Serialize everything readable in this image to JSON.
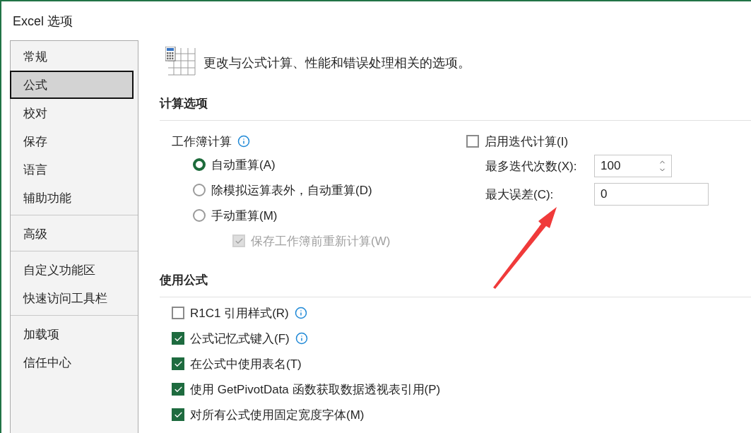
{
  "window": {
    "title": "Excel 选项"
  },
  "sidebar": {
    "groups": [
      [
        {
          "label": "常规",
          "selected": false
        },
        {
          "label": "公式",
          "selected": true
        },
        {
          "label": "校对",
          "selected": false
        },
        {
          "label": "保存",
          "selected": false
        },
        {
          "label": "语言",
          "selected": false
        },
        {
          "label": "辅助功能",
          "selected": false
        }
      ],
      [
        {
          "label": "高级",
          "selected": false
        }
      ],
      [
        {
          "label": "自定义功能区",
          "selected": false
        },
        {
          "label": "快速访问工具栏",
          "selected": false
        }
      ],
      [
        {
          "label": "加载项",
          "selected": false
        },
        {
          "label": "信任中心",
          "selected": false
        }
      ]
    ]
  },
  "header": {
    "text": "更改与公式计算、性能和错误处理相关的选项。"
  },
  "calculation": {
    "title": "计算选项",
    "workbook_label": "工作簿计算",
    "workbook_info": true,
    "radios": [
      {
        "label": "自动重算(A)",
        "selected": true
      },
      {
        "label": "除模拟运算表外，自动重算(D)",
        "selected": false
      },
      {
        "label": "手动重算(M)",
        "selected": false
      }
    ],
    "save_before": {
      "label": "保存工作簿前重新计算(W)",
      "checked": true,
      "disabled": true
    },
    "iteration": {
      "label": "启用迭代计算(I)",
      "checked": false
    },
    "fields": [
      {
        "label": "最多迭代次数(X):",
        "value": "100",
        "kind": "spinner"
      },
      {
        "label": "最大误差(C):",
        "value": "0",
        "kind": "text"
      }
    ]
  },
  "formulas": {
    "title": "使用公式",
    "options": [
      {
        "label": "R1C1 引用样式(R)",
        "checked": false,
        "info": true
      },
      {
        "label": "公式记忆式键入(F)",
        "checked": true,
        "info": true
      },
      {
        "label": "在公式中使用表名(T)",
        "checked": true,
        "info": false
      },
      {
        "label": "使用 GetPivotData 函数获取数据透视表引用(P)",
        "checked": true,
        "info": false
      },
      {
        "label": "对所有公式使用固定宽度字体(M)",
        "checked": true,
        "info": false
      }
    ]
  }
}
